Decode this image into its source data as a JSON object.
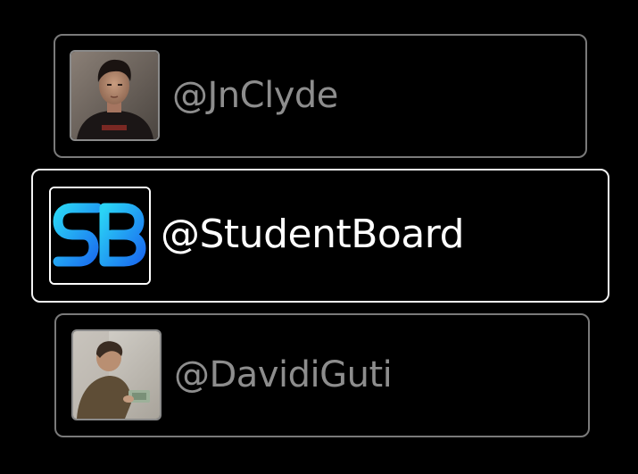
{
  "accounts": [
    {
      "handle": "@JnClyde",
      "state": "inactive",
      "avatar": "person-photo"
    },
    {
      "handle": "@StudentBoard",
      "state": "selected",
      "avatar": "studentboard-logo"
    },
    {
      "handle": "@DavidiGuti",
      "state": "inactive",
      "avatar": "person-photo"
    }
  ],
  "colors": {
    "background": "#000000",
    "inactive_border": "#7a7a7a",
    "inactive_text": "#8d8d8d",
    "active_border": "#f2f2f2",
    "active_text": "#ffffff",
    "logo_gradient_start": "#2ad4f5",
    "logo_gradient_end": "#1a6cf0"
  }
}
